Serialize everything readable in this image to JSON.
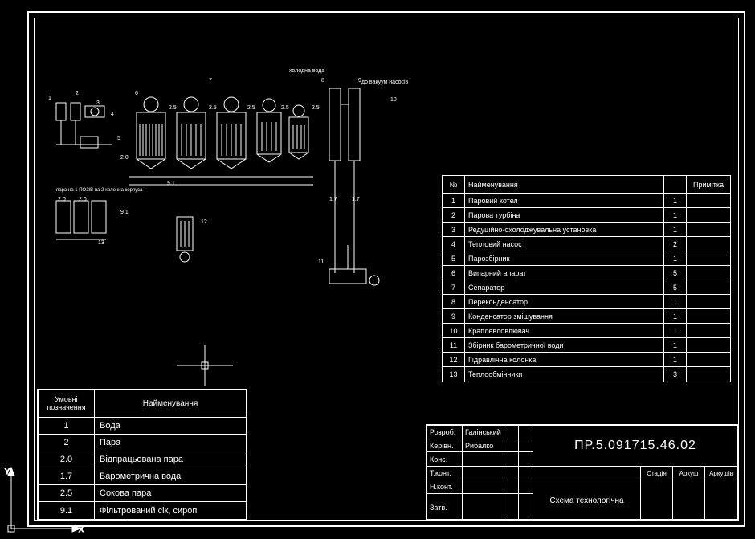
{
  "schematic": {
    "labels_top": {
      "kholodna_voda": "холодна вода",
      "do_vakuum_nasosiv": "до вакуум насосів"
    },
    "labels_left": {
      "para_na_1_poziv": "пара на 1 ПОЗіВ на 2\nколонна корпуса"
    },
    "callouts": [
      "1",
      "2",
      "3",
      "4",
      "5",
      "6",
      "7",
      "8",
      "9",
      "10",
      "11",
      "12",
      "13"
    ],
    "stream_labels": [
      "2.0",
      "2.0",
      "2.0",
      "9.1",
      "9.1",
      "2.5",
      "2.5",
      "2.5",
      "2.5",
      "2.5",
      "1.7",
      "1.7"
    ]
  },
  "equipment": {
    "headers": {
      "num": "№",
      "name": "Найменування",
      "qty": "",
      "note": "Примітка"
    },
    "rows": [
      {
        "num": "1",
        "name": "Паровий котел",
        "qty": "1",
        "note": ""
      },
      {
        "num": "2",
        "name": "Парова турбіна",
        "qty": "1",
        "note": ""
      },
      {
        "num": "3",
        "name": "Редуційно-охолоджувальна установка",
        "qty": "1",
        "note": ""
      },
      {
        "num": "4",
        "name": "Тепловий насос",
        "qty": "2",
        "note": ""
      },
      {
        "num": "5",
        "name": "Парозбірник",
        "qty": "1",
        "note": ""
      },
      {
        "num": "6",
        "name": "Випарний апарат",
        "qty": "5",
        "note": ""
      },
      {
        "num": "7",
        "name": "Сепаратор",
        "qty": "5",
        "note": ""
      },
      {
        "num": "8",
        "name": "Переконденсатор",
        "qty": "1",
        "note": ""
      },
      {
        "num": "9",
        "name": "Конденсатор змішування",
        "qty": "1",
        "note": ""
      },
      {
        "num": "10",
        "name": "Краплевловлювач",
        "qty": "1",
        "note": ""
      },
      {
        "num": "11",
        "name": "Збірник барометричної води",
        "qty": "1",
        "note": ""
      },
      {
        "num": "12",
        "name": "Гідравлічна колонка",
        "qty": "1",
        "note": ""
      },
      {
        "num": "13",
        "name": "Теплообмінники",
        "qty": "3",
        "note": ""
      }
    ]
  },
  "legend": {
    "headers": {
      "sym": "Умовні\nпозначення",
      "name": "Найменування"
    },
    "rows": [
      {
        "sym": "1",
        "name": "Вода"
      },
      {
        "sym": "2",
        "name": "Пара"
      },
      {
        "sym": "2.0",
        "name": "Відпрацьована пара"
      },
      {
        "sym": "1.7",
        "name": "Барометрична вода"
      },
      {
        "sym": "2.5",
        "name": "Сокова пара"
      },
      {
        "sym": "9.1",
        "name": "Фільтрований сік, сироп"
      }
    ]
  },
  "titleblock": {
    "doc_number": "ПР.5.091715.46.02",
    "subtitle": "Схема технологічна",
    "rows": {
      "razrab": {
        "label": "Розроб.",
        "name": "Галінський"
      },
      "kerivn": {
        "label": "Керівн.",
        "name": "Рибалко"
      },
      "kons": {
        "label": "Конс.",
        "name": ""
      },
      "tkont": {
        "label": "Т.конт.",
        "name": ""
      },
      "nkont": {
        "label": "Н.конт.",
        "name": ""
      },
      "zatv": {
        "label": "Затв.",
        "name": ""
      }
    },
    "cols": {
      "stadia": "Стадія",
      "arkush": "Аркуш",
      "arkushiv": "Аркушів"
    }
  }
}
